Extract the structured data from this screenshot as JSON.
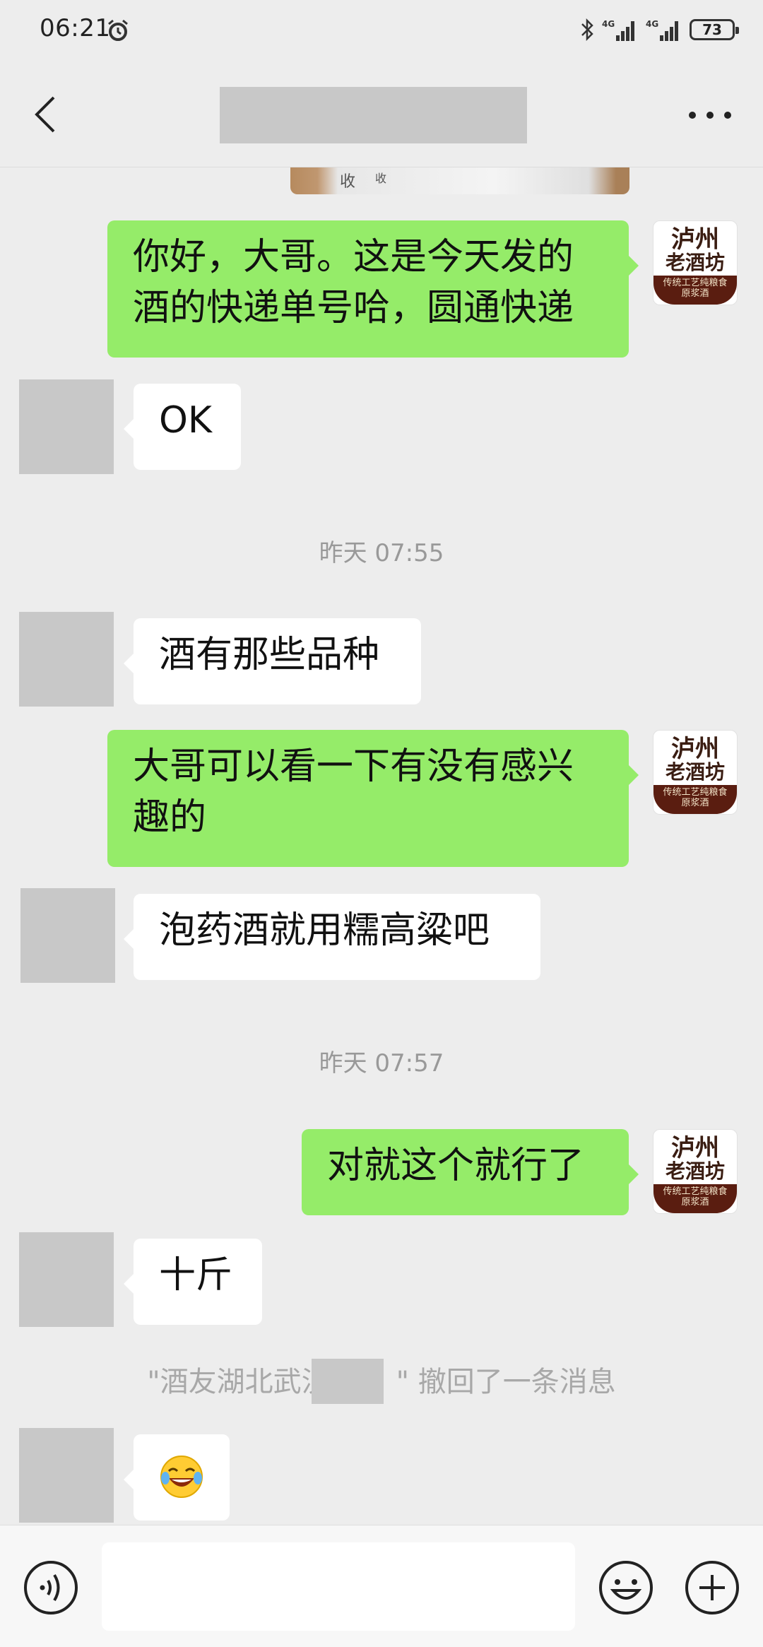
{
  "status_bar": {
    "time": "06:21",
    "network": "4G",
    "battery": "73",
    "icons": [
      "alarm-icon",
      "bluetooth-icon",
      "signal-icon",
      "battery-icon"
    ]
  },
  "nav": {
    "back_icon": "chevron-left-icon",
    "more_icon": "more-dots-icon"
  },
  "brand_avatar": {
    "line1": "泸州",
    "line2": "老酒坊",
    "tagline1": "传统工艺纯粮食",
    "tagline2": "原浆酒"
  },
  "image_peek_text": [
    "收",
    "收"
  ],
  "messages": [
    {
      "side": "right",
      "text": "你好，大哥。这是今天发的酒的快递单号哈，圆通快递"
    },
    {
      "side": "left",
      "text": "OK"
    },
    {
      "type": "time",
      "text": "昨天 07:55"
    },
    {
      "side": "left",
      "text": "酒有那些品种"
    },
    {
      "side": "right",
      "text": "大哥可以看一下有没有感兴趣的"
    },
    {
      "side": "left",
      "text": "泡药酒就用糯高粱吧"
    },
    {
      "type": "time",
      "text": "昨天 07:57"
    },
    {
      "side": "right",
      "text": "对就这个就行了"
    },
    {
      "side": "left",
      "text": "十斤"
    },
    {
      "type": "recall",
      "text": "\"酒友湖北武汉    \" 撤回了一条消息"
    },
    {
      "side": "left",
      "emoji": "laughing-tears-emoji"
    }
  ],
  "recall_visible_left": "\"酒友湖北武汉",
  "recall_visible_right": "\" 撤回了一条消息",
  "input_bar": {
    "placeholder": "",
    "voice_icon": "voice-icon",
    "emoji_icon": "emoji-icon",
    "plus_icon": "plus-icon"
  },
  "colors": {
    "background": "#ededed",
    "sent_bubble": "#95ec69",
    "received_bubble": "#ffffff",
    "timestamp": "#999999",
    "mask": "#c8c8c8"
  }
}
